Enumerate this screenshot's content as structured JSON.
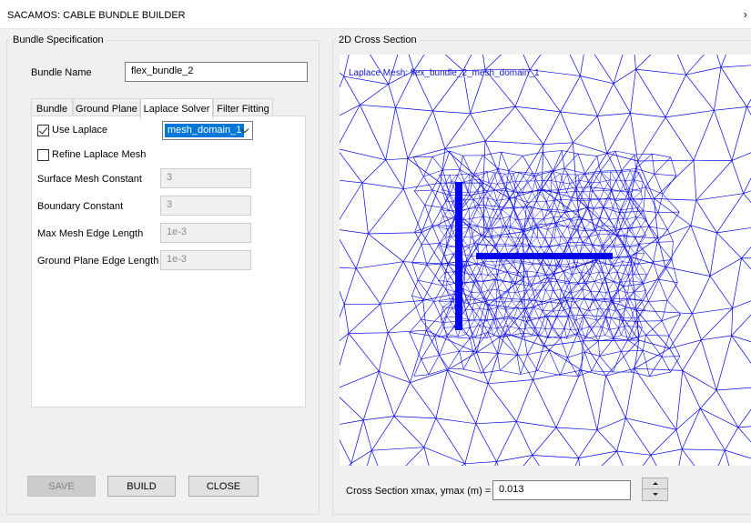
{
  "window": {
    "title": "SACAMOS: CABLE BUNDLE BUILDER",
    "close_glyph": "›"
  },
  "spec": {
    "group_title": "Bundle Specification",
    "bundle_name_label": "Bundle Name",
    "bundle_name_value": "flex_bundle_2",
    "tabs": [
      {
        "label": "Bundle"
      },
      {
        "label": "Ground Plane"
      },
      {
        "label": "Laplace Solver"
      },
      {
        "label": "Filter Fitting"
      }
    ],
    "use_laplace_label": "Use Laplace",
    "use_laplace_checked": true,
    "mesh_domain_selected": "mesh_domain_1",
    "refine_label": "Refine Laplace Mesh",
    "refine_checked": false,
    "fields": [
      {
        "label": "Surface Mesh Constant",
        "value": "3"
      },
      {
        "label": "Boundary Constant",
        "value": "3"
      },
      {
        "label": "Max Mesh Edge Length",
        "value": "1e-3"
      },
      {
        "label": "Ground Plane Edge Length",
        "value": "1e-3"
      }
    ]
  },
  "buttons": {
    "save": "SAVE",
    "build": "BUILD",
    "close": "CLOSE"
  },
  "cross_section": {
    "group_title": "2D Cross Section",
    "mesh_label": "Laplace Mesh: flex_bundle_2_mesh_domain_1",
    "mesh_color": "#0000ee",
    "xmax_label": "Cross Section xmax, ymax (m) =",
    "xmax_value": "0.013"
  }
}
